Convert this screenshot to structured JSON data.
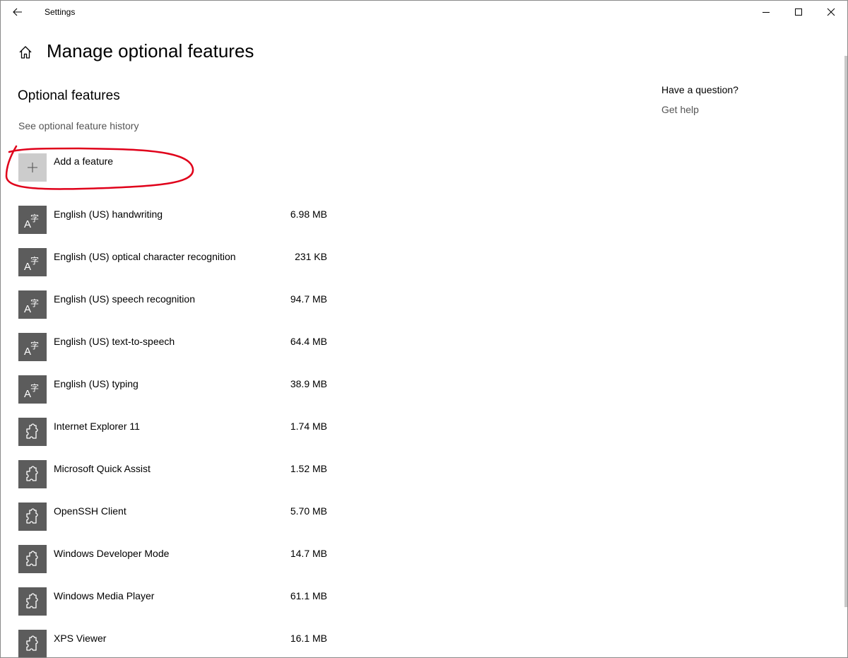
{
  "window": {
    "title": "Settings"
  },
  "header": {
    "title": "Manage optional features"
  },
  "main": {
    "section_title": "Optional features",
    "history_link": "See optional feature history",
    "add_feature_label": "Add a feature",
    "features": [
      {
        "name": "English (US) handwriting",
        "size": "6.98 MB",
        "icon": "language-icon"
      },
      {
        "name": "English (US) optical character recognition",
        "size": "231 KB",
        "icon": "language-icon"
      },
      {
        "name": "English (US) speech recognition",
        "size": "94.7 MB",
        "icon": "language-icon"
      },
      {
        "name": "English (US) text-to-speech",
        "size": "64.4 MB",
        "icon": "language-icon"
      },
      {
        "name": "English (US) typing",
        "size": "38.9 MB",
        "icon": "language-icon"
      },
      {
        "name": "Internet Explorer 11",
        "size": "1.74 MB",
        "icon": "puzzle-icon"
      },
      {
        "name": "Microsoft Quick Assist",
        "size": "1.52 MB",
        "icon": "puzzle-icon"
      },
      {
        "name": "OpenSSH Client",
        "size": "5.70 MB",
        "icon": "puzzle-icon"
      },
      {
        "name": "Windows Developer Mode",
        "size": "14.7 MB",
        "icon": "puzzle-icon"
      },
      {
        "name": "Windows Media Player",
        "size": "61.1 MB",
        "icon": "puzzle-icon"
      },
      {
        "name": "XPS Viewer",
        "size": "16.1 MB",
        "icon": "puzzle-icon"
      }
    ]
  },
  "help": {
    "title": "Have a question?",
    "link": "Get help"
  },
  "colors": {
    "icon_bg": "#5c5c5c",
    "add_bg": "#cccccc",
    "annotation": "#e0001a",
    "link": "#555555"
  }
}
